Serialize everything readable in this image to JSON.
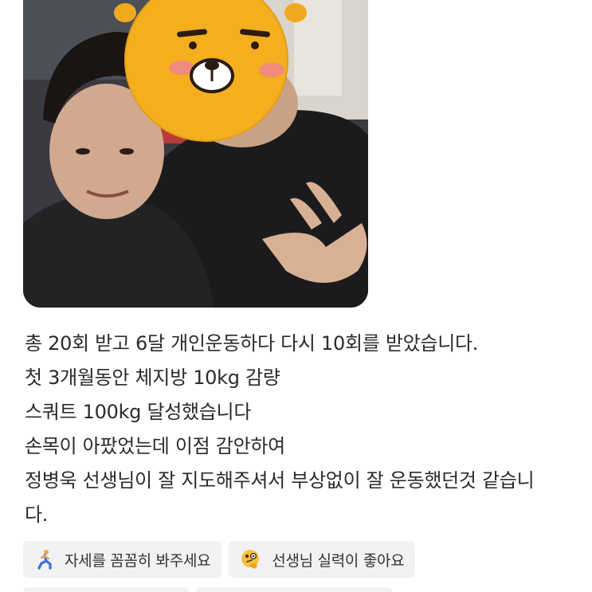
{
  "photo": {
    "description_icon": "kakao-ryan-sticker-icon",
    "background_color": "#2a2a2e"
  },
  "review": {
    "lines": [
      "총 20회 받고 6달 개인운동하다 다시 10회를 받았습니다.",
      "첫 3개월동안 체지방 10kg 감량",
      "스쿼트 100kg 달성했습니다",
      "손목이 아팠었는데 이점 감안하여",
      "정병욱 선생님이 잘 지도해주셔서 부상없이 잘 운동했던것 같습니",
      "다."
    ]
  },
  "tags": [
    {
      "icon": "person-lunge-icon",
      "label": "자세를 꼼꼼히 봐주세요"
    },
    {
      "icon": "thinking-face-icon",
      "label": "선생님 실력이 좋아요"
    }
  ]
}
